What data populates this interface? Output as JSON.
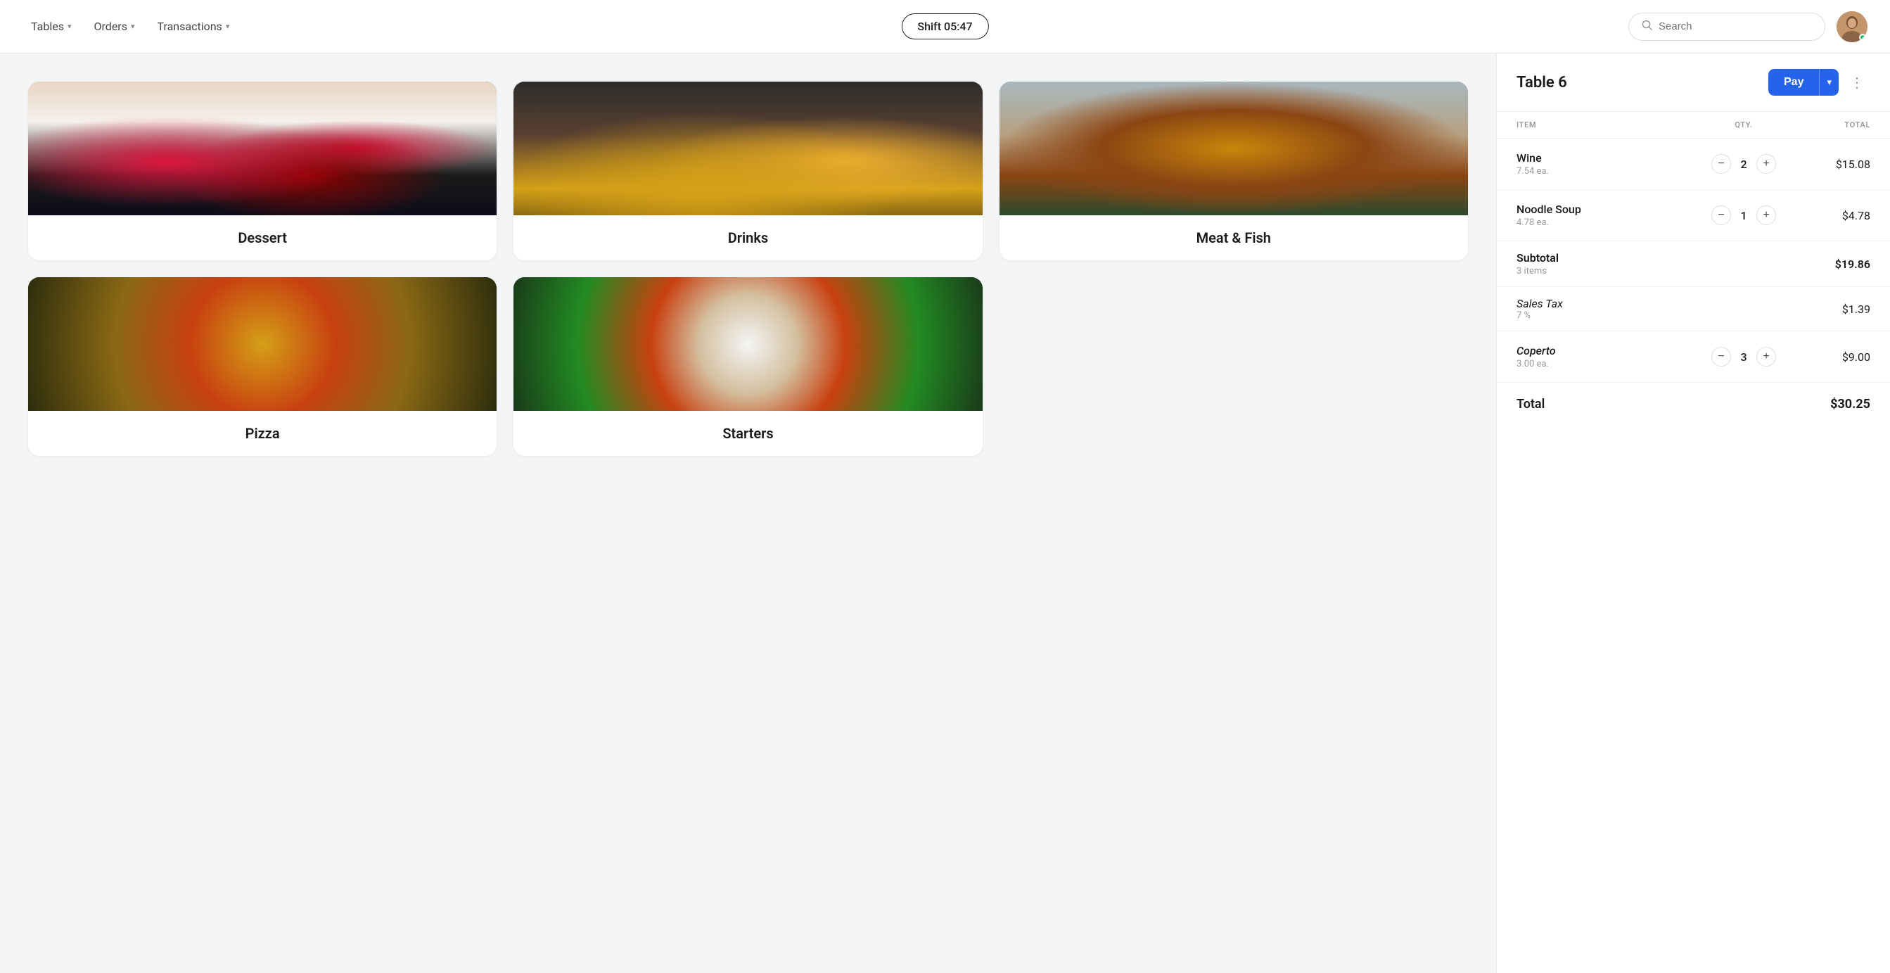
{
  "header": {
    "nav": [
      {
        "label": "Tables",
        "id": "tables"
      },
      {
        "label": "Orders",
        "id": "orders"
      },
      {
        "label": "Transactions",
        "id": "transactions"
      }
    ],
    "shift": "Shift 05:47",
    "search_placeholder": "Search"
  },
  "categories": [
    {
      "id": "dessert",
      "label": "Dessert",
      "img_class": "img-dessert"
    },
    {
      "id": "drinks",
      "label": "Drinks",
      "img_class": "img-drinks"
    },
    {
      "id": "meat-fish",
      "label": "Meat & Fish",
      "img_class": "img-meat"
    },
    {
      "id": "pizza",
      "label": "Pizza",
      "img_class": "img-pizza"
    },
    {
      "id": "starters",
      "label": "Starters",
      "img_class": "img-starters"
    }
  ],
  "order": {
    "table_label": "Table 6",
    "pay_label": "Pay",
    "columns": {
      "item": "ITEM",
      "qty": "QTY.",
      "total": "TOTAL"
    },
    "items": [
      {
        "name": "Wine",
        "price_ea": "7.54 ea.",
        "qty": 2,
        "total": "$15.08"
      },
      {
        "name": "Noodle Soup",
        "price_ea": "4.78 ea.",
        "qty": 1,
        "total": "$4.78"
      }
    ],
    "subtotal": {
      "label": "Subtotal",
      "sublabel": "3 items",
      "value": "$19.86"
    },
    "tax": {
      "label": "Sales Tax",
      "sublabel": "7 %",
      "value": "$1.39"
    },
    "coperto": {
      "label": "Coperto",
      "price_ea": "3.00 ea.",
      "qty": 3,
      "total": "$9.00"
    },
    "total": {
      "label": "Total",
      "value": "$30.25"
    }
  }
}
